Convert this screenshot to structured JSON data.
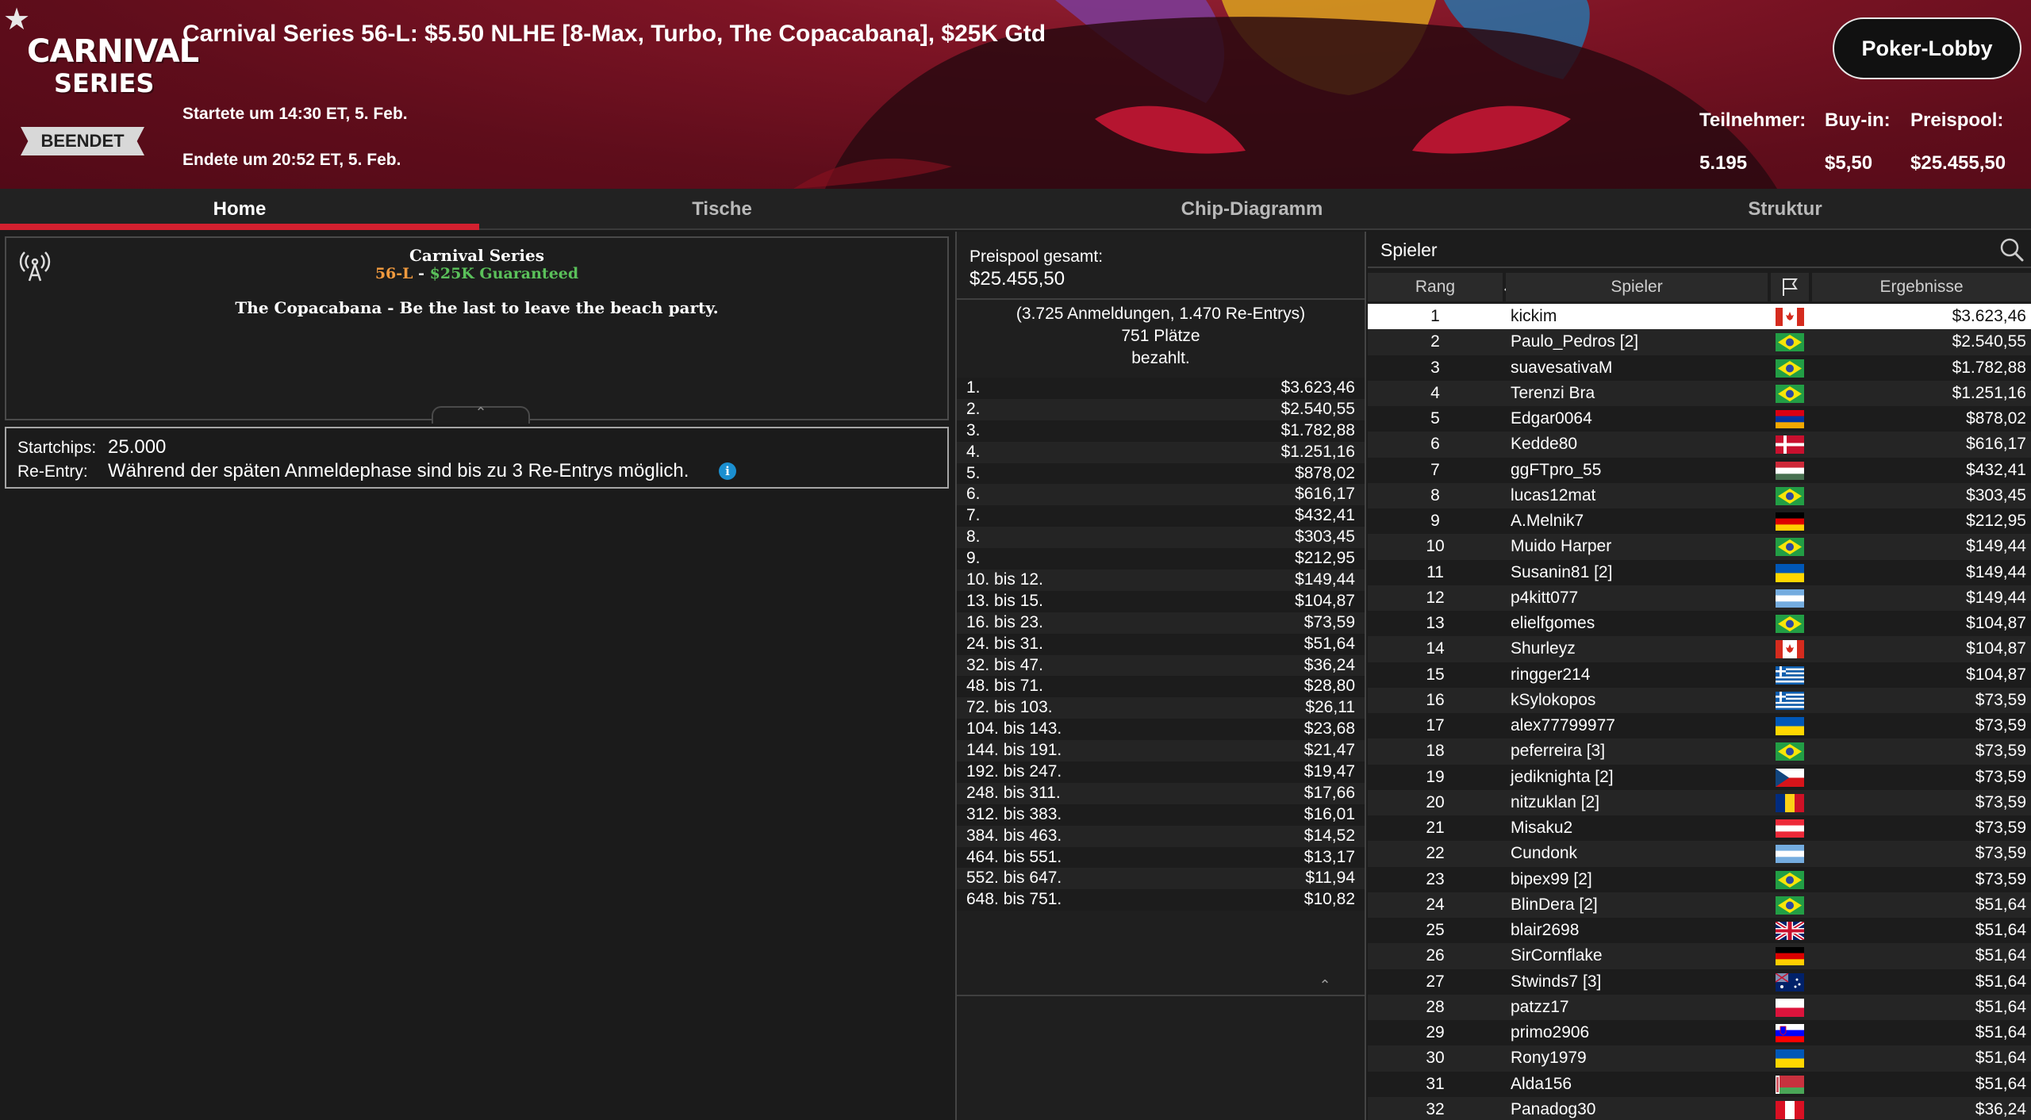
{
  "header": {
    "title": "Carnival Series 56-L: $5.50 NLHE [8-Max, Turbo, The Copacabana], $25K Gtd",
    "logo_line1": "CARNIVAL",
    "logo_line2": "SERIES",
    "status": "BEENDET",
    "started": "Startete um 14:30 ET, 5. Feb.",
    "ended": "Endete um 20:52 ET, 5. Feb.",
    "lobby_button": "Poker-Lobby",
    "stats": {
      "entrants_label": "Teilnehmer:",
      "entrants_value": "5.195",
      "buyin_label": "Buy-in:",
      "buyin_value": "$5,50",
      "prizepool_label": "Preispool:",
      "prizepool_value": "$25.455,50"
    }
  },
  "tabs": [
    "Home",
    "Tische",
    "Chip-Diagramm",
    "Struktur"
  ],
  "info": {
    "line1": "Carnival Series",
    "line2_a": "56-L",
    "line2_b": " - ",
    "line2_c": "$25K Guaranteed",
    "line3": "The Copacabana - Be the last to leave the beach party."
  },
  "details": {
    "startchips_label": "Startchips:",
    "startchips_value": "25.000",
    "reentry_label": "Re-Entry:",
    "reentry_value": "Während der späten Anmeldephase sind bis zu 3 Re-Entrys möglich.",
    "info_icon_glyph": "i"
  },
  "prizes": {
    "label": "Preispool gesamt:",
    "value": "$25.455,50",
    "meta1": "(3.725 Anmeldungen, 1.470 Re-Entrys)",
    "meta2": "751 Plätze",
    "meta3": "bezahlt.",
    "payouts": [
      [
        "1.",
        "$3.623,46"
      ],
      [
        "2.",
        "$2.540,55"
      ],
      [
        "3.",
        "$1.782,88"
      ],
      [
        "4.",
        "$1.251,16"
      ],
      [
        "5.",
        "$878,02"
      ],
      [
        "6.",
        "$616,17"
      ],
      [
        "7.",
        "$432,41"
      ],
      [
        "8.",
        "$303,45"
      ],
      [
        "9.",
        "$212,95"
      ],
      [
        "10. bis 12.",
        "$149,44"
      ],
      [
        "13. bis 15.",
        "$104,87"
      ],
      [
        "16. bis 23.",
        "$73,59"
      ],
      [
        "24. bis 31.",
        "$51,64"
      ],
      [
        "32. bis 47.",
        "$36,24"
      ],
      [
        "48. bis 71.",
        "$28,80"
      ],
      [
        "72. bis 103.",
        "$26,11"
      ],
      [
        "104. bis 143.",
        "$23,68"
      ],
      [
        "144. bis 191.",
        "$21,47"
      ],
      [
        "192. bis 247.",
        "$19,47"
      ],
      [
        "248. bis 311.",
        "$17,66"
      ],
      [
        "312. bis 383.",
        "$16,01"
      ],
      [
        "384. bis 463.",
        "$14,52"
      ],
      [
        "464. bis 551.",
        "$13,17"
      ],
      [
        "552. bis 647.",
        "$11,94"
      ],
      [
        "648. bis 751.",
        "$10,82"
      ]
    ]
  },
  "players": {
    "search_label": "Spieler",
    "col_rank": "Rang",
    "col_player": "Spieler",
    "col_result": "Ergebnisse",
    "rows": [
      [
        "1",
        "kickim",
        "ca",
        "$3.623,46"
      ],
      [
        "2",
        "Paulo_Pedros [2]",
        "br",
        "$2.540,55"
      ],
      [
        "3",
        "suavesativaM",
        "br",
        "$1.782,88"
      ],
      [
        "4",
        "Terenzi Bra",
        "br",
        "$1.251,16"
      ],
      [
        "5",
        "Edgar0064",
        "am",
        "$878,02"
      ],
      [
        "6",
        "Kedde80",
        "dk",
        "$616,17"
      ],
      [
        "7",
        "ggFTpro_55",
        "hu",
        "$432,41"
      ],
      [
        "8",
        "lucas12mat",
        "br",
        "$303,45"
      ],
      [
        "9",
        "A.Melnik7",
        "de",
        "$212,95"
      ],
      [
        "10",
        "Muido Harper",
        "br",
        "$149,44"
      ],
      [
        "11",
        "Susanin81 [2]",
        "ua",
        "$149,44"
      ],
      [
        "12",
        "p4kitt077",
        "ar",
        "$149,44"
      ],
      [
        "13",
        "elielfgomes",
        "br",
        "$104,87"
      ],
      [
        "14",
        "Shurleyz",
        "ca",
        "$104,87"
      ],
      [
        "15",
        "ringger214",
        "gr",
        "$104,87"
      ],
      [
        "16",
        "kSylokopos",
        "gr",
        "$73,59"
      ],
      [
        "17",
        "alex77799977",
        "ua",
        "$73,59"
      ],
      [
        "18",
        "peferreira [3]",
        "br",
        "$73,59"
      ],
      [
        "19",
        "jediknighta [2]",
        "cz",
        "$73,59"
      ],
      [
        "20",
        "nitzuklan [2]",
        "ro",
        "$73,59"
      ],
      [
        "21",
        "Misaku2",
        "at",
        "$73,59"
      ],
      [
        "22",
        "Cundonk",
        "ar",
        "$73,59"
      ],
      [
        "23",
        "bipex99 [2]",
        "br",
        "$73,59"
      ],
      [
        "24",
        "BlinDera [2]",
        "br",
        "$51,64"
      ],
      [
        "25",
        "blair2698",
        "gb",
        "$51,64"
      ],
      [
        "26",
        "SirCornflake",
        "de",
        "$51,64"
      ],
      [
        "27",
        "Stwinds7 [3]",
        "au",
        "$51,64"
      ],
      [
        "28",
        "patzz17",
        "pl",
        "$51,64"
      ],
      [
        "29",
        "primo2906",
        "si",
        "$51,64"
      ],
      [
        "30",
        "Rony1979",
        "ua",
        "$51,64"
      ],
      [
        "31",
        "Alda156",
        "by",
        "$51,64"
      ],
      [
        "32",
        "Panadog30",
        "pe",
        "$36,24"
      ]
    ]
  },
  "colors": {
    "accent_red": "#d3202f",
    "orange": "#f19a3e",
    "green": "#5ac05a",
    "info_blue": "#1b8fd0"
  }
}
